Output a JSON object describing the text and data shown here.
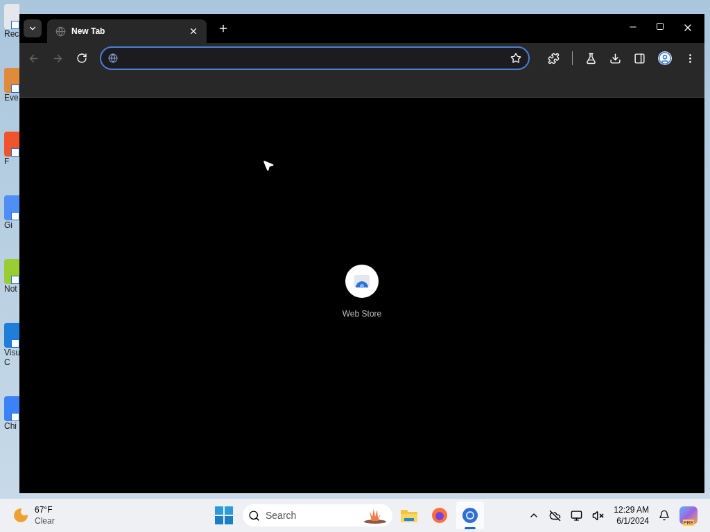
{
  "desktop_icons": [
    {
      "lines": [
        "Rec"
      ]
    },
    {
      "lines": [
        "Eve"
      ]
    },
    {
      "lines": [
        "F"
      ]
    },
    {
      "lines": [
        "Gi"
      ]
    },
    {
      "lines": [
        "Not"
      ]
    },
    {
      "lines": [
        "Visu",
        "C"
      ]
    },
    {
      "lines": [
        "Chi"
      ]
    }
  ],
  "browser": {
    "tabs": [
      {
        "title": "New Tab",
        "selected": true
      }
    ],
    "toolbar": {
      "back_disabled": true,
      "forward_disabled": true,
      "address": {
        "focused": true
      }
    },
    "shortcuts": [
      {
        "label": "Web Store"
      }
    ]
  },
  "taskbar": {
    "weather": {
      "temperature": "67°F",
      "condition": "Clear"
    },
    "search": {
      "placeholder": "Search"
    },
    "apps": [
      {
        "kind": "files",
        "running": false
      },
      {
        "kind": "firefox",
        "running": false
      },
      {
        "kind": "chrome",
        "running": true
      }
    ],
    "clock": {
      "time": "12:29 AM",
      "date": "6/1/2024"
    },
    "copilot_badge": "PRE"
  }
}
